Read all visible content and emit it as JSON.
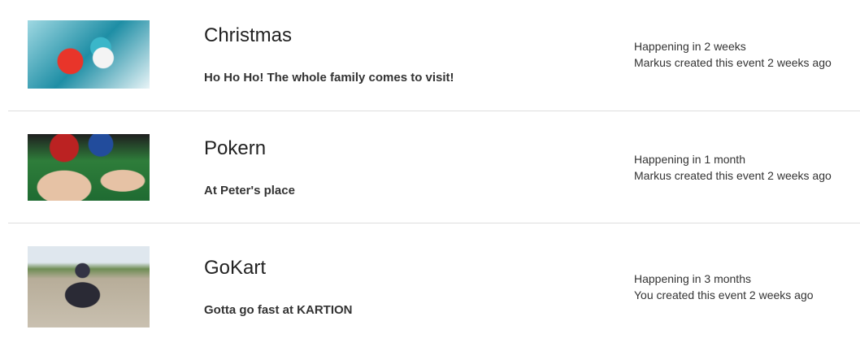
{
  "events": [
    {
      "title": "Christmas",
      "description": "Ho Ho Ho! The whole family comes to visit!",
      "happening": "Happening in 2 weeks",
      "created": "Markus created this event 2 weeks ago",
      "image": "snowmen-photo"
    },
    {
      "title": "Pokern",
      "description": "At Peter's place",
      "happening": "Happening in 1 month",
      "created": "Markus created this event 2 weeks ago",
      "image": "poker-chips-photo"
    },
    {
      "title": "GoKart",
      "description": "Gotta go fast at KARTION",
      "happening": "Happening in 3 months",
      "created": "You created this event 2 weeks ago",
      "image": "gokart-photo"
    }
  ]
}
